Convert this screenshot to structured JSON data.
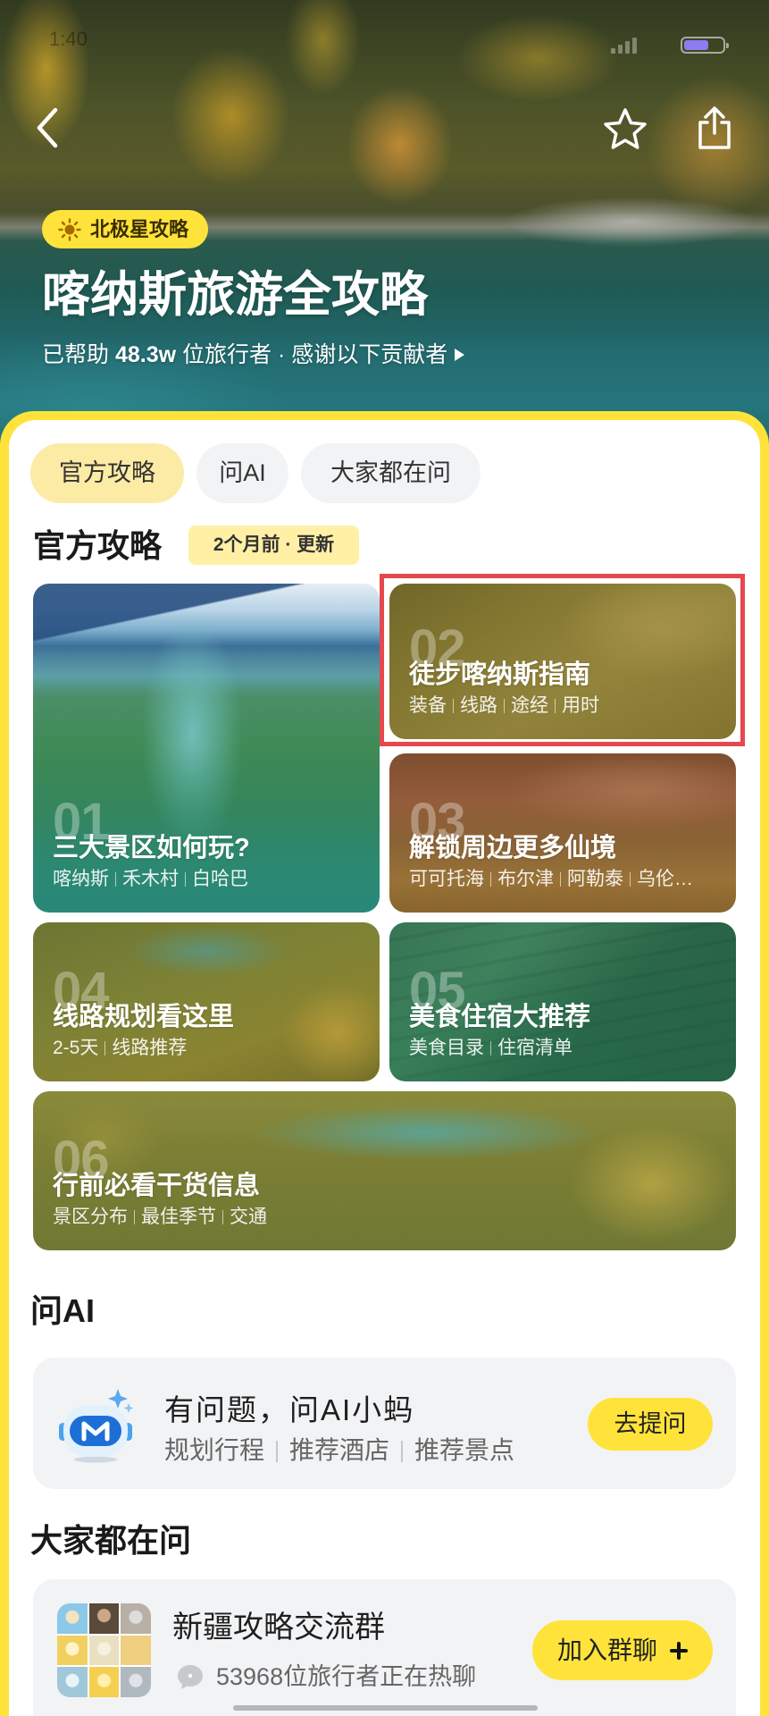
{
  "colors": {
    "accent_yellow": "#FFE33A",
    "highlight_red": "#E5484D"
  },
  "status_bar": {
    "time": "1:40",
    "signal_icon": "signal-icon",
    "battery_icon": "battery-icon",
    "battery_level": 0.65
  },
  "header": {
    "back_icon": "chevron-left-icon",
    "favorite_icon": "star-icon",
    "share_icon": "share-icon",
    "badge": {
      "icon": "sun-icon",
      "label": "北极星攻略"
    },
    "title": "喀纳斯旅游全攻略",
    "subtitle": {
      "prefix": "已帮助",
      "count": "48.3w",
      "suffix": "位旅行者",
      "separator": "·",
      "contributors_link": "感谢以下贡献者",
      "arrow_icon": "play-arrow-icon"
    }
  },
  "tabs": [
    {
      "label": "官方攻略",
      "active": true
    },
    {
      "label": "问AI",
      "active": false
    },
    {
      "label": "大家都在问",
      "active": false
    }
  ],
  "official_guide": {
    "heading": "官方攻略",
    "update_badge": "2个月前 · 更新",
    "cards": [
      {
        "number": "01",
        "title": "三大景区如何玩?",
        "tags": [
          "喀纳斯",
          "禾木村",
          "白哈巴"
        ]
      },
      {
        "number": "02",
        "title": "徒步喀纳斯指南",
        "tags": [
          "装备",
          "线路",
          "途经",
          "用时"
        ]
      },
      {
        "number": "03",
        "title": "解锁周边更多仙境",
        "tags": [
          "可可托海",
          "布尔津",
          "阿勒泰",
          "乌伦…"
        ]
      },
      {
        "number": "04",
        "title": "线路规划看这里",
        "tags": [
          "2-5天",
          "线路推荐"
        ]
      },
      {
        "number": "05",
        "title": "美食住宿大推荐",
        "tags": [
          "美食目录",
          "住宿清单"
        ]
      },
      {
        "number": "06",
        "title": "行前必看干货信息",
        "tags": [
          "景区分布",
          "最佳季节",
          "交通"
        ]
      }
    ]
  },
  "ask_ai": {
    "heading": "问AI",
    "icon": "ai-robot-icon",
    "title": "有问题，问AI小蚂",
    "tags": [
      "规划行程",
      "推荐酒店",
      "推荐景点"
    ],
    "button": "去提问"
  },
  "community": {
    "heading": "大家都在问",
    "group": {
      "avatar": "group-avatar-grid",
      "name": "新疆攻略交流群",
      "chat_icon": "chat-bubble-icon",
      "activity": "53968位旅行者正在热聊",
      "button": "加入群聊",
      "button_icon": "plus-icon"
    }
  }
}
